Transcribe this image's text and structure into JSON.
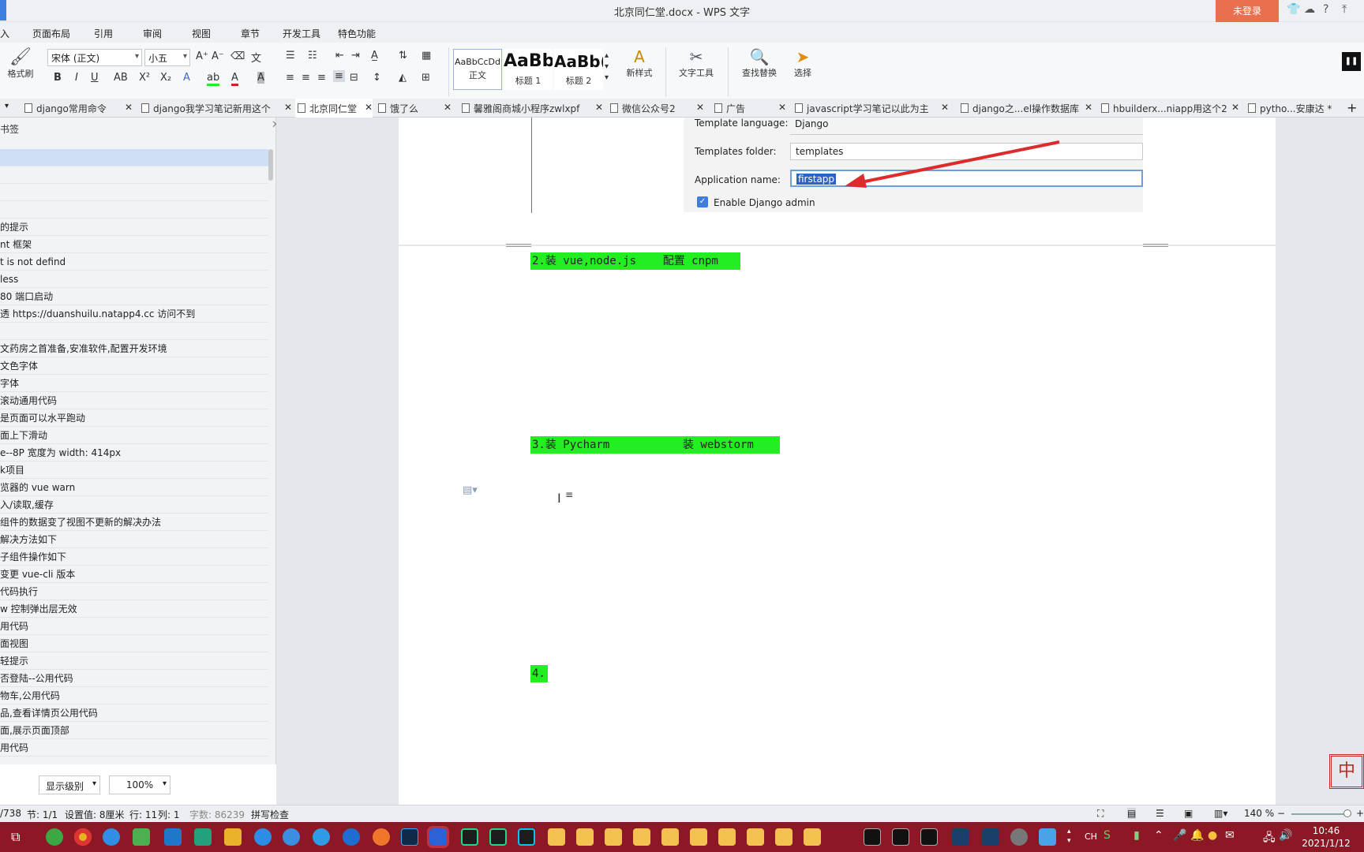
{
  "window": {
    "title": "北京同仁堂.docx - WPS 文字",
    "login_button": "未登录",
    "help": "?"
  },
  "menu": {
    "items": [
      "入",
      "页面布局",
      "引用",
      "审阅",
      "视图",
      "章节",
      "开发工具",
      "特色功能"
    ]
  },
  "ribbon": {
    "format_painter": "格式刷",
    "font_name": "宋体 (正文)",
    "font_size": "小五",
    "styles": [
      {
        "preview": "AaBbCcDd",
        "label": "正文"
      },
      {
        "preview": "AaBb",
        "label": "标题 1"
      },
      {
        "preview": "AaBb(",
        "label": "标题 2"
      }
    ],
    "new_style": "新样式",
    "text_tools": "文字工具",
    "find_replace": "查找替换",
    "select": "选择"
  },
  "tabs": [
    {
      "label": "django常用命令",
      "active": false
    },
    {
      "label": "django我学习笔记新用这个",
      "active": false
    },
    {
      "label": "北京同仁堂",
      "active": true
    },
    {
      "label": "饿了么",
      "active": false
    },
    {
      "label": "馨雅阁商城小程序zwlxpf",
      "active": false
    },
    {
      "label": "微信公众号2",
      "active": false
    },
    {
      "label": "广告",
      "active": false
    },
    {
      "label": "javascript学习笔记以此为主",
      "active": false
    },
    {
      "label": "django之...el操作数据库",
      "active": false
    },
    {
      "label": "hbuilderx...niapp用这个2",
      "active": false
    },
    {
      "label": "pytho...安康达 *",
      "active": false
    }
  ],
  "nav": {
    "header": "书签",
    "items": [
      "",
      "",
      "",
      "",
      "的提示",
      "nt 框架",
      "t is not defind",
      " less",
      " 80 端口启动",
      "透 https://duanshuilu.natapp4.cc 访问不到",
      "",
      "文药房之首准备,安准软件,配置开发环境",
      "文色字体",
      "字体",
      "滚动通用代码",
      "是页面可以水平跑动",
      "面上下滑动",
      "e--8P 宽度为 width: 414px",
      "k项目",
      "览器的 vue warn",
      "入/读取,缓存",
      "组件的数据变了视图不更新的解决办法",
      "解决方法如下",
      "子组件操作如下",
      "变更 vue-cli 版本",
      "代码执行",
      "w 控制弹出层无效",
      "用代码",
      "面视图",
      " 轻提示",
      "否登陆--公用代码",
      "物车,公用代码",
      "品,查看详情页公用代码",
      "面,展示页面顶部",
      "用代码"
    ],
    "level_select": "显示级别",
    "zoom_select": "100%"
  },
  "django_panel": {
    "template_language_label": "Template language:",
    "template_language_value": "Django",
    "templates_folder_label": "Templates folder:",
    "templates_folder_value": "templates",
    "application_name_label": "Application name:",
    "application_name_value": "firstapp",
    "enable_admin_label": "Enable Django admin"
  },
  "document": {
    "line2": "2.装 vue,node.js    配置 cnpm",
    "line3": "3.装 Pycharm           装 webstorm",
    "line4": "4."
  },
  "status": {
    "page": "/738",
    "section": "节: 1/1",
    "setting": "设置值: 8厘米",
    "row": "行: 11",
    "col": "列: 1",
    "wordcount": "字数: 86239",
    "spellcheck": "拼写检查",
    "zoom": "140 %"
  },
  "taskbar": {
    "time": "10:46",
    "date": "2021/1/12",
    "ime": "CH"
  },
  "colors": {
    "highlight": "#22ee22",
    "login": "#e96f4f",
    "taskbar": "#8c1826",
    "arrow": "#dd2b2b"
  }
}
